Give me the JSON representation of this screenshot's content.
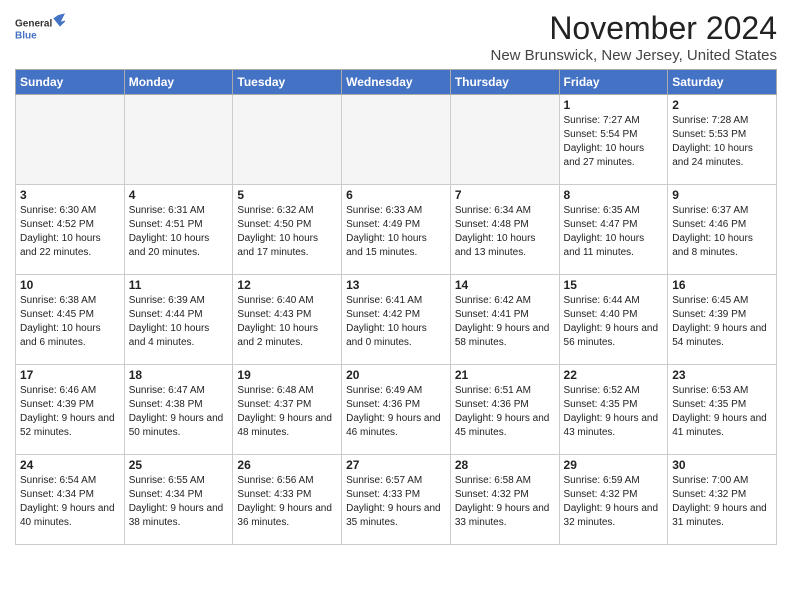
{
  "logo": {
    "line1": "General",
    "line2": "Blue"
  },
  "header": {
    "month": "November 2024",
    "location": "New Brunswick, New Jersey, United States"
  },
  "weekdays": [
    "Sunday",
    "Monday",
    "Tuesday",
    "Wednesday",
    "Thursday",
    "Friday",
    "Saturday"
  ],
  "weeks": [
    [
      {
        "day": "",
        "info": ""
      },
      {
        "day": "",
        "info": ""
      },
      {
        "day": "",
        "info": ""
      },
      {
        "day": "",
        "info": ""
      },
      {
        "day": "",
        "info": ""
      },
      {
        "day": "1",
        "info": "Sunrise: 7:27 AM\nSunset: 5:54 PM\nDaylight: 10 hours and 27 minutes."
      },
      {
        "day": "2",
        "info": "Sunrise: 7:28 AM\nSunset: 5:53 PM\nDaylight: 10 hours and 24 minutes."
      }
    ],
    [
      {
        "day": "3",
        "info": "Sunrise: 6:30 AM\nSunset: 4:52 PM\nDaylight: 10 hours and 22 minutes."
      },
      {
        "day": "4",
        "info": "Sunrise: 6:31 AM\nSunset: 4:51 PM\nDaylight: 10 hours and 20 minutes."
      },
      {
        "day": "5",
        "info": "Sunrise: 6:32 AM\nSunset: 4:50 PM\nDaylight: 10 hours and 17 minutes."
      },
      {
        "day": "6",
        "info": "Sunrise: 6:33 AM\nSunset: 4:49 PM\nDaylight: 10 hours and 15 minutes."
      },
      {
        "day": "7",
        "info": "Sunrise: 6:34 AM\nSunset: 4:48 PM\nDaylight: 10 hours and 13 minutes."
      },
      {
        "day": "8",
        "info": "Sunrise: 6:35 AM\nSunset: 4:47 PM\nDaylight: 10 hours and 11 minutes."
      },
      {
        "day": "9",
        "info": "Sunrise: 6:37 AM\nSunset: 4:46 PM\nDaylight: 10 hours and 8 minutes."
      }
    ],
    [
      {
        "day": "10",
        "info": "Sunrise: 6:38 AM\nSunset: 4:45 PM\nDaylight: 10 hours and 6 minutes."
      },
      {
        "day": "11",
        "info": "Sunrise: 6:39 AM\nSunset: 4:44 PM\nDaylight: 10 hours and 4 minutes."
      },
      {
        "day": "12",
        "info": "Sunrise: 6:40 AM\nSunset: 4:43 PM\nDaylight: 10 hours and 2 minutes."
      },
      {
        "day": "13",
        "info": "Sunrise: 6:41 AM\nSunset: 4:42 PM\nDaylight: 10 hours and 0 minutes."
      },
      {
        "day": "14",
        "info": "Sunrise: 6:42 AM\nSunset: 4:41 PM\nDaylight: 9 hours and 58 minutes."
      },
      {
        "day": "15",
        "info": "Sunrise: 6:44 AM\nSunset: 4:40 PM\nDaylight: 9 hours and 56 minutes."
      },
      {
        "day": "16",
        "info": "Sunrise: 6:45 AM\nSunset: 4:39 PM\nDaylight: 9 hours and 54 minutes."
      }
    ],
    [
      {
        "day": "17",
        "info": "Sunrise: 6:46 AM\nSunset: 4:39 PM\nDaylight: 9 hours and 52 minutes."
      },
      {
        "day": "18",
        "info": "Sunrise: 6:47 AM\nSunset: 4:38 PM\nDaylight: 9 hours and 50 minutes."
      },
      {
        "day": "19",
        "info": "Sunrise: 6:48 AM\nSunset: 4:37 PM\nDaylight: 9 hours and 48 minutes."
      },
      {
        "day": "20",
        "info": "Sunrise: 6:49 AM\nSunset: 4:36 PM\nDaylight: 9 hours and 46 minutes."
      },
      {
        "day": "21",
        "info": "Sunrise: 6:51 AM\nSunset: 4:36 PM\nDaylight: 9 hours and 45 minutes."
      },
      {
        "day": "22",
        "info": "Sunrise: 6:52 AM\nSunset: 4:35 PM\nDaylight: 9 hours and 43 minutes."
      },
      {
        "day": "23",
        "info": "Sunrise: 6:53 AM\nSunset: 4:35 PM\nDaylight: 9 hours and 41 minutes."
      }
    ],
    [
      {
        "day": "24",
        "info": "Sunrise: 6:54 AM\nSunset: 4:34 PM\nDaylight: 9 hours and 40 minutes."
      },
      {
        "day": "25",
        "info": "Sunrise: 6:55 AM\nSunset: 4:34 PM\nDaylight: 9 hours and 38 minutes."
      },
      {
        "day": "26",
        "info": "Sunrise: 6:56 AM\nSunset: 4:33 PM\nDaylight: 9 hours and 36 minutes."
      },
      {
        "day": "27",
        "info": "Sunrise: 6:57 AM\nSunset: 4:33 PM\nDaylight: 9 hours and 35 minutes."
      },
      {
        "day": "28",
        "info": "Sunrise: 6:58 AM\nSunset: 4:32 PM\nDaylight: 9 hours and 33 minutes."
      },
      {
        "day": "29",
        "info": "Sunrise: 6:59 AM\nSunset: 4:32 PM\nDaylight: 9 hours and 32 minutes."
      },
      {
        "day": "30",
        "info": "Sunrise: 7:00 AM\nSunset: 4:32 PM\nDaylight: 9 hours and 31 minutes."
      }
    ]
  ]
}
